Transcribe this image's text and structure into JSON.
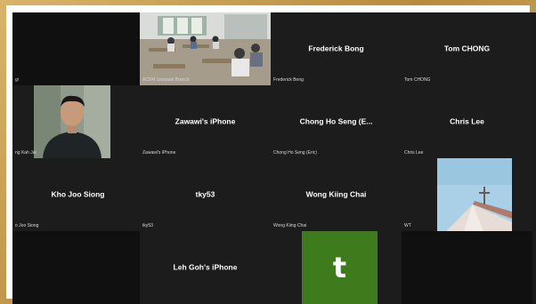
{
  "participants": [
    {
      "id": "p1",
      "display": "",
      "name": "gi"
    },
    {
      "id": "p2",
      "display": "",
      "name": "ACEM Sarawak Branch"
    },
    {
      "id": "p3",
      "display": "Frederick Bong",
      "name": "Frederick Bong"
    },
    {
      "id": "p4",
      "display": "Tom CHONG",
      "name": "Tom CHONG"
    },
    {
      "id": "p5",
      "display": "",
      "name": "ng Kah Jai"
    },
    {
      "id": "p6",
      "display": "Zawawi's iPhone",
      "name": "Zawawi's iPhone"
    },
    {
      "id": "p7",
      "display": "Chong Ho Seng (E...",
      "name": "Chong Ho Seng (Eric)"
    },
    {
      "id": "p8",
      "display": "Chris Lee",
      "name": "Chris Lee"
    },
    {
      "id": "p9",
      "display": "Kho Joo Siong",
      "name": "o Joo Siong"
    },
    {
      "id": "p10",
      "display": "tky53",
      "name": "tky53"
    },
    {
      "id": "p11",
      "display": "Wong Kiing Chai",
      "name": "Wong Kiing Chai"
    },
    {
      "id": "p12",
      "display": "",
      "name": "WT"
    },
    {
      "id": "p13",
      "display": "",
      "name": ""
    },
    {
      "id": "p14",
      "display": "Leh Goh's iPhone",
      "name": ""
    },
    {
      "id": "p15",
      "display": "",
      "name": "",
      "avatar_letter": "t"
    },
    {
      "id": "p16",
      "display": "",
      "name": ""
    }
  ],
  "colors": {
    "tile_bg": "#1c1c1c",
    "avatar_green": "#3d7b1c",
    "frame": "#c9a45a"
  }
}
